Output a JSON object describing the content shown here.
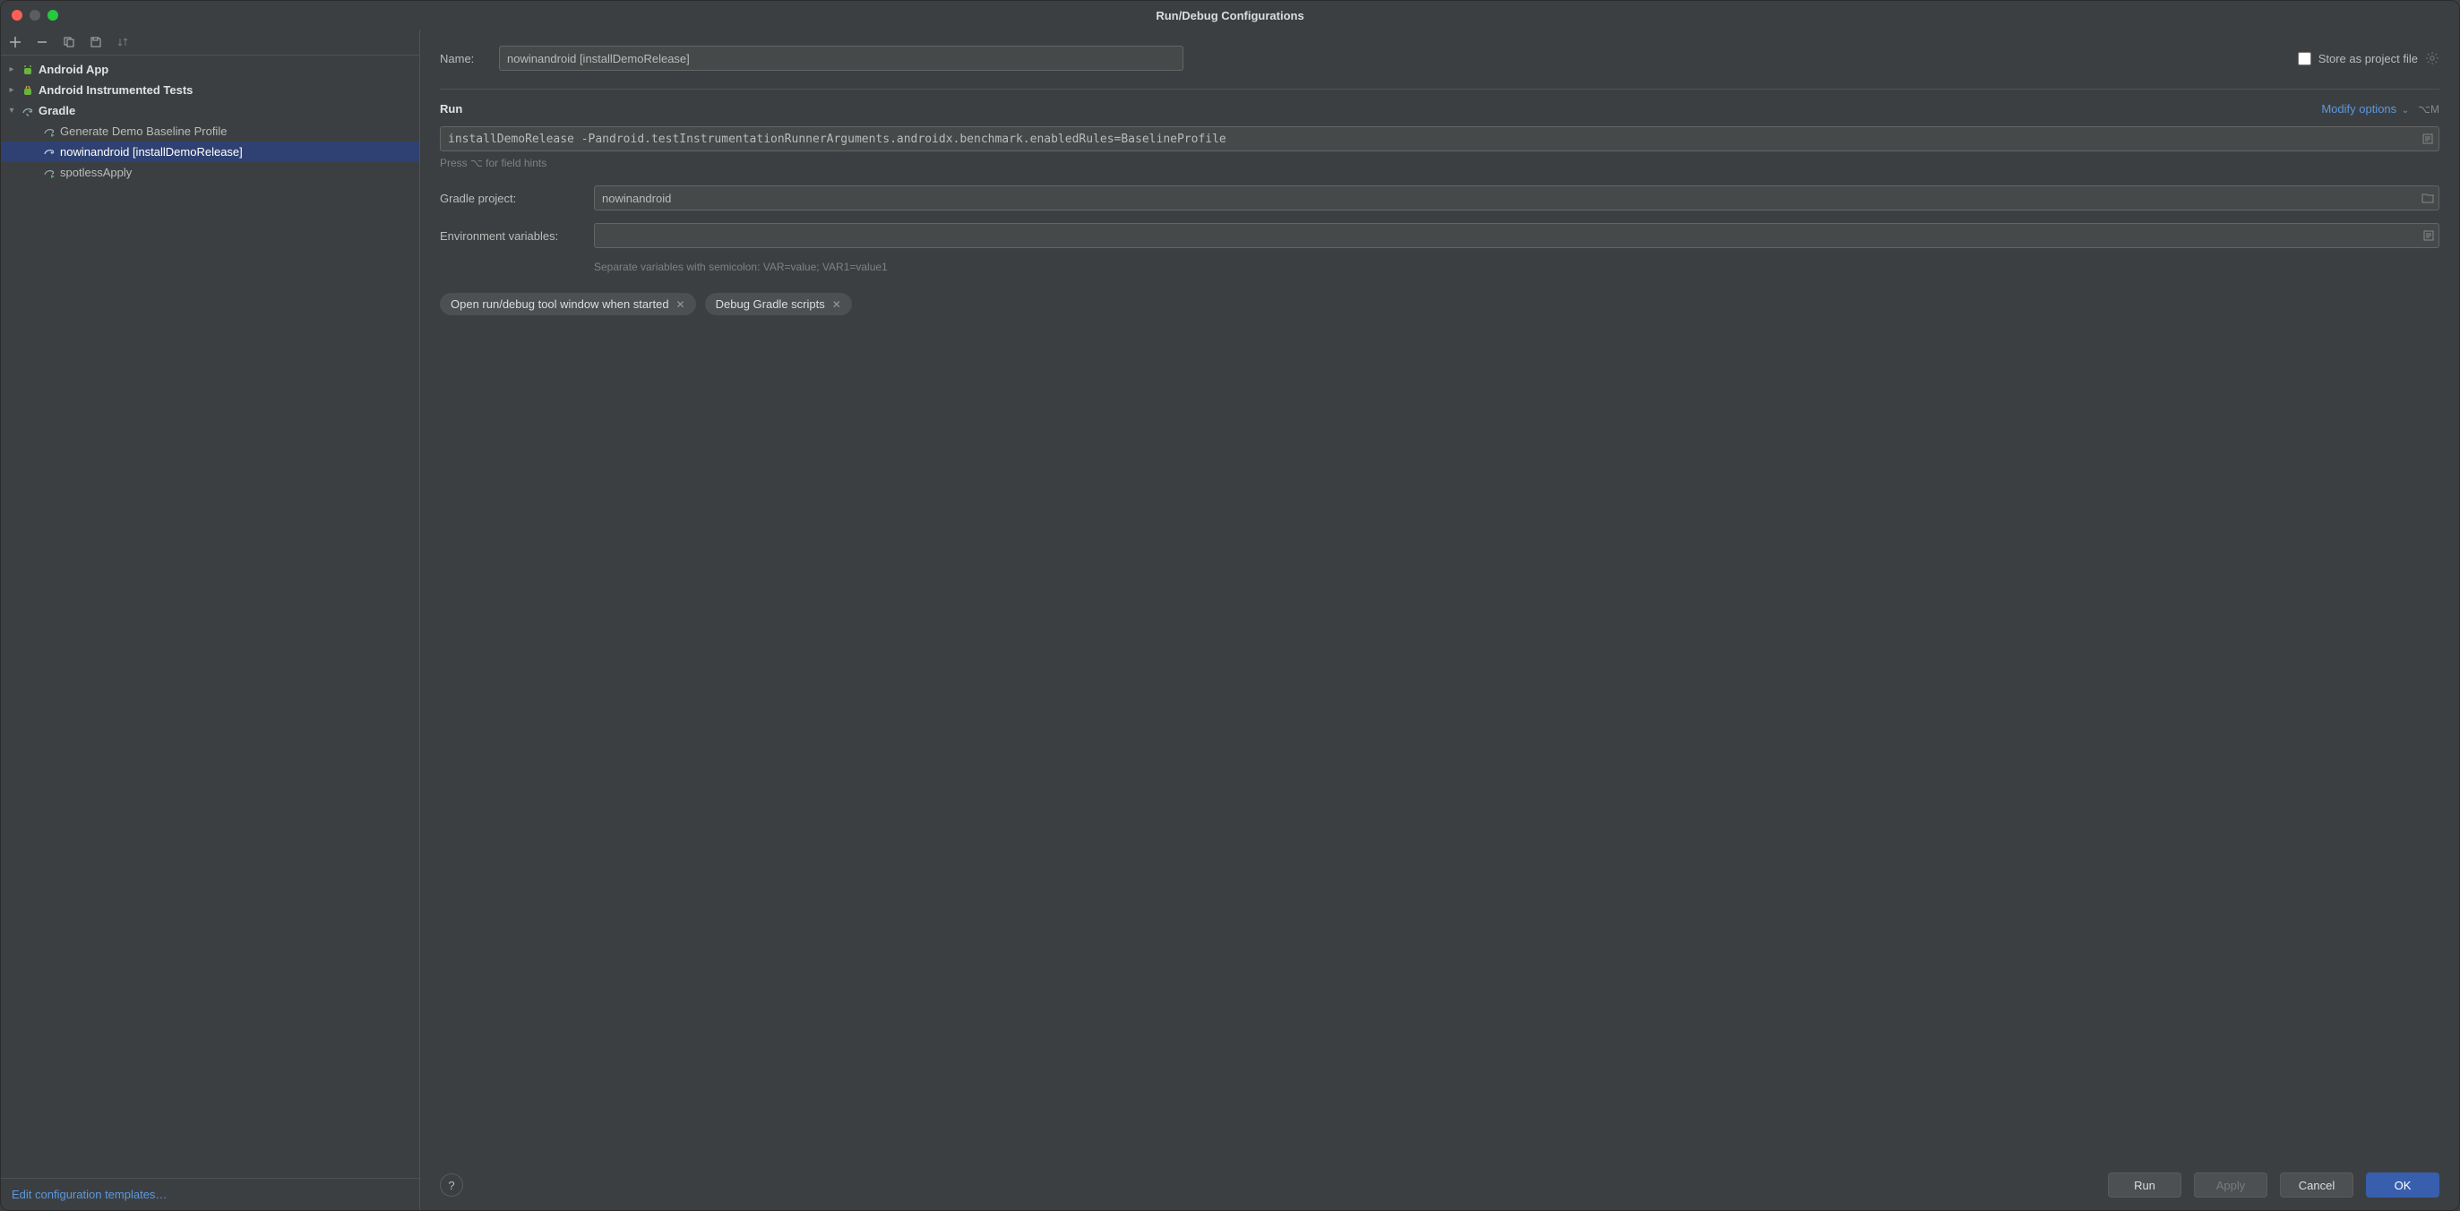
{
  "window": {
    "title": "Run/Debug Configurations"
  },
  "tree": {
    "androidApp": "Android App",
    "androidTests": "Android Instrumented Tests",
    "gradle": "Gradle",
    "items": [
      "Generate Demo Baseline Profile",
      "nowinandroid [installDemoRelease]",
      "spotlessApply"
    ]
  },
  "editLink": "Edit configuration templates…",
  "form": {
    "nameLabel": "Name:",
    "nameValue": "nowinandroid [installDemoRelease]",
    "storeLabel": "Store as project file",
    "runTitle": "Run",
    "modifyOptions": "Modify options",
    "modifyShortcut": "⌥M",
    "runCmd": "installDemoRelease -Pandroid.testInstrumentationRunnerArguments.androidx.benchmark.enabledRules=BaselineProfile",
    "hint": "Press ⌥ for field hints",
    "gradleProjectLabel": "Gradle project:",
    "gradleProjectValue": "nowinandroid",
    "envLabel": "Environment variables:",
    "envValue": "",
    "envNote": "Separate variables with semicolon: VAR=value; VAR1=value1",
    "chip1": "Open run/debug tool window when started",
    "chip2": "Debug Gradle scripts"
  },
  "buttons": {
    "run": "Run",
    "apply": "Apply",
    "cancel": "Cancel",
    "ok": "OK"
  }
}
